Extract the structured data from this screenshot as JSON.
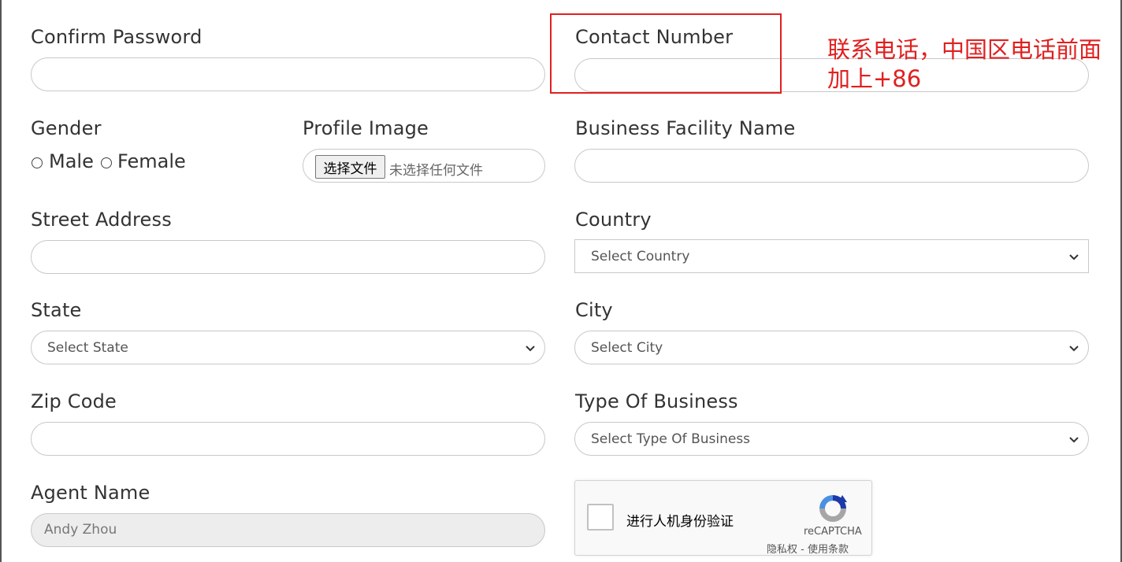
{
  "form": {
    "confirm_password": {
      "label": "Confirm Password",
      "value": ""
    },
    "contact_number": {
      "label": "Contact Number",
      "value": ""
    },
    "gender": {
      "label": "Gender",
      "options": [
        "Male",
        "Female"
      ],
      "selected": null
    },
    "profile_image": {
      "label": "Profile Image",
      "button_label": "选择文件",
      "status_text": "未选择任何文件"
    },
    "business_facility_name": {
      "label": "Business Facility Name",
      "value": ""
    },
    "street_address": {
      "label": "Street Address",
      "value": ""
    },
    "country": {
      "label": "Country",
      "selected": "Select Country"
    },
    "state": {
      "label": "State",
      "selected": "Select State"
    },
    "city": {
      "label": "City",
      "selected": "Select City"
    },
    "zip_code": {
      "label": "Zip Code",
      "value": ""
    },
    "type_of_business": {
      "label": "Type Of Business",
      "selected": "Select Type Of Business"
    },
    "agent_name": {
      "label": "Agent Name",
      "value": "Andy Zhou",
      "disabled": true
    }
  },
  "recaptcha": {
    "checkbox_label": "进行人机身份验证",
    "brand": "reCAPTCHA",
    "privacy_link": "隐私权",
    "separator": "-",
    "terms_link": "使用条款",
    "checked": false
  },
  "annotation": {
    "line1": "联系电话，中国区电话前面",
    "line2": "加上+86",
    "color": "#e02020"
  }
}
